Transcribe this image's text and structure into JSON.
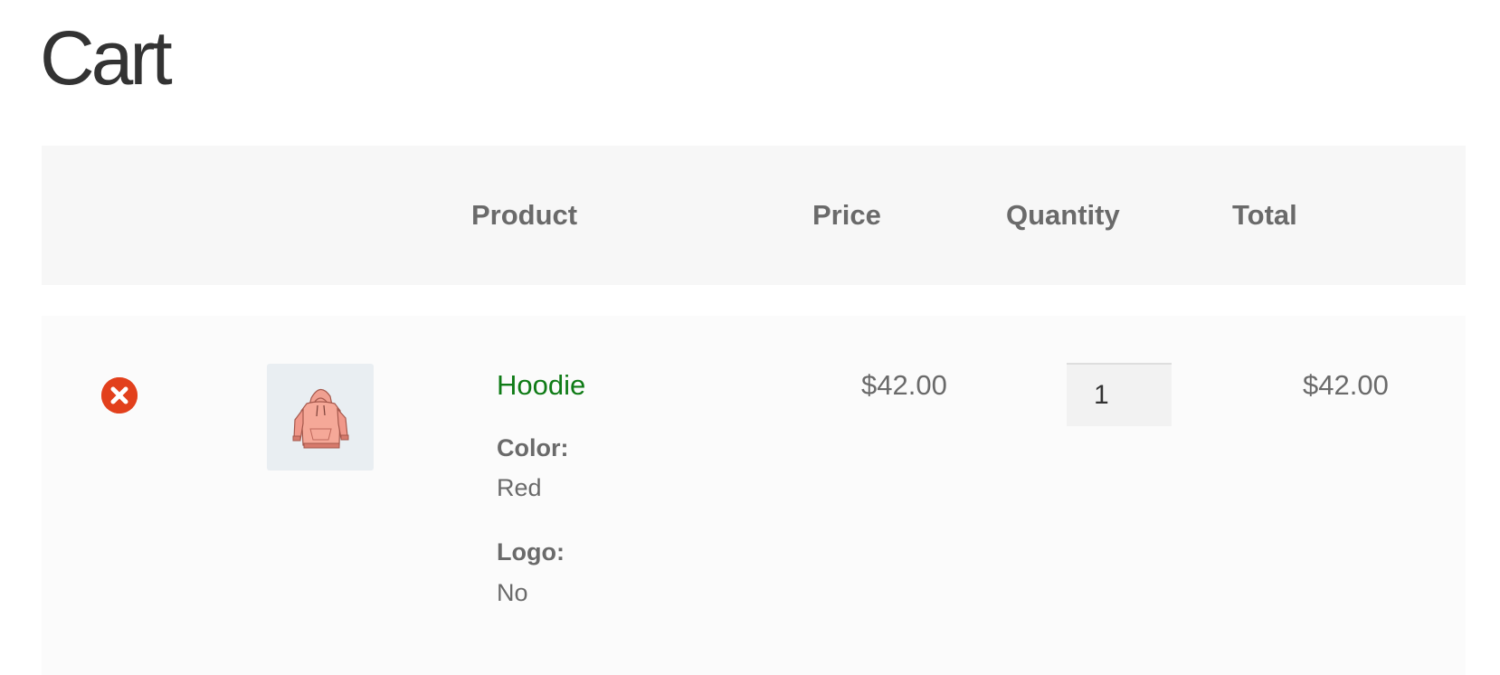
{
  "page": {
    "title": "Cart"
  },
  "table": {
    "headers": {
      "product": "Product",
      "price": "Price",
      "quantity": "Quantity",
      "total": "Total"
    },
    "items": [
      {
        "name": "Hoodie",
        "thumbnail_icon": "hoodie-icon",
        "remove_icon": "remove-icon",
        "meta": [
          {
            "label": "Color:",
            "value": "Red"
          },
          {
            "label": "Logo:",
            "value": "No"
          }
        ],
        "price": "$42.00",
        "quantity": "1",
        "total": "$42.00"
      }
    ]
  },
  "colors": {
    "link": "#0f7b16",
    "remove": "#e2401c",
    "header_bg": "#f7f7f7",
    "row_bg": "#fbfbfb"
  }
}
